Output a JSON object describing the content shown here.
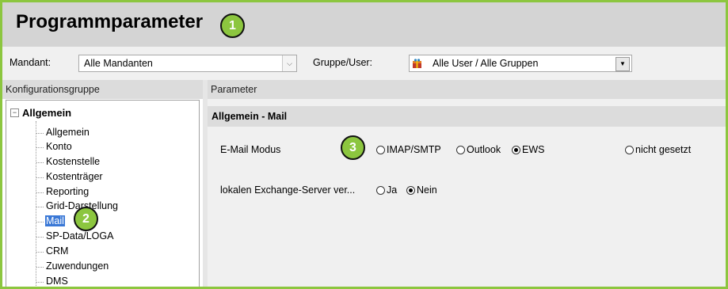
{
  "window": {
    "title": "Programmparameter"
  },
  "badges": [
    "1",
    "2",
    "3"
  ],
  "filter": {
    "mandant_label": "Mandant:",
    "mandant_value": "Alle Mandanten",
    "gruppe_label": "Gruppe/User:",
    "gruppe_value": "Alle User / Alle Gruppen"
  },
  "left_panel": {
    "header": "Konfigurationsgruppe",
    "root": "Allgemein",
    "items": [
      "Allgemein",
      "Konto",
      "Kostenstelle",
      "Kostenträger",
      "Reporting",
      "Grid-Darstellung",
      "Mail",
      "SP-Data/LOGA",
      "CRM",
      "Zuwendungen",
      "DMS"
    ],
    "selected": "Mail"
  },
  "right_panel": {
    "header": "Parameter",
    "section_title": "Allgemein - Mail",
    "params": [
      {
        "label": "E-Mail Modus",
        "options": [
          "IMAP/SMTP",
          "Outlook",
          "EWS",
          "nicht gesetzt"
        ],
        "selected": "EWS"
      },
      {
        "label": "lokalen  Exchange-Server ver...",
        "options": [
          "Ja",
          "Nein"
        ],
        "selected": "Nein"
      }
    ]
  },
  "colors": {
    "accent": "#8cc63f",
    "selection": "#3a78d6",
    "header_bg": "#d4d4d4"
  }
}
